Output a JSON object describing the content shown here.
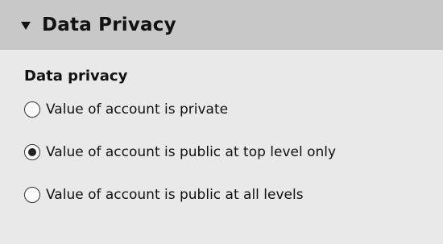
{
  "panel": {
    "header_title": "Data Privacy",
    "section_title": "Data privacy",
    "options": [
      {
        "label": "Value of account is private",
        "selected": false
      },
      {
        "label": "Value of account is public at top level only",
        "selected": true
      },
      {
        "label": "Value of account is public at all levels",
        "selected": false
      }
    ]
  },
  "colors": {
    "header_background": "#c8c8c8",
    "body_background": "#e9e9e9",
    "text": "#111111"
  }
}
